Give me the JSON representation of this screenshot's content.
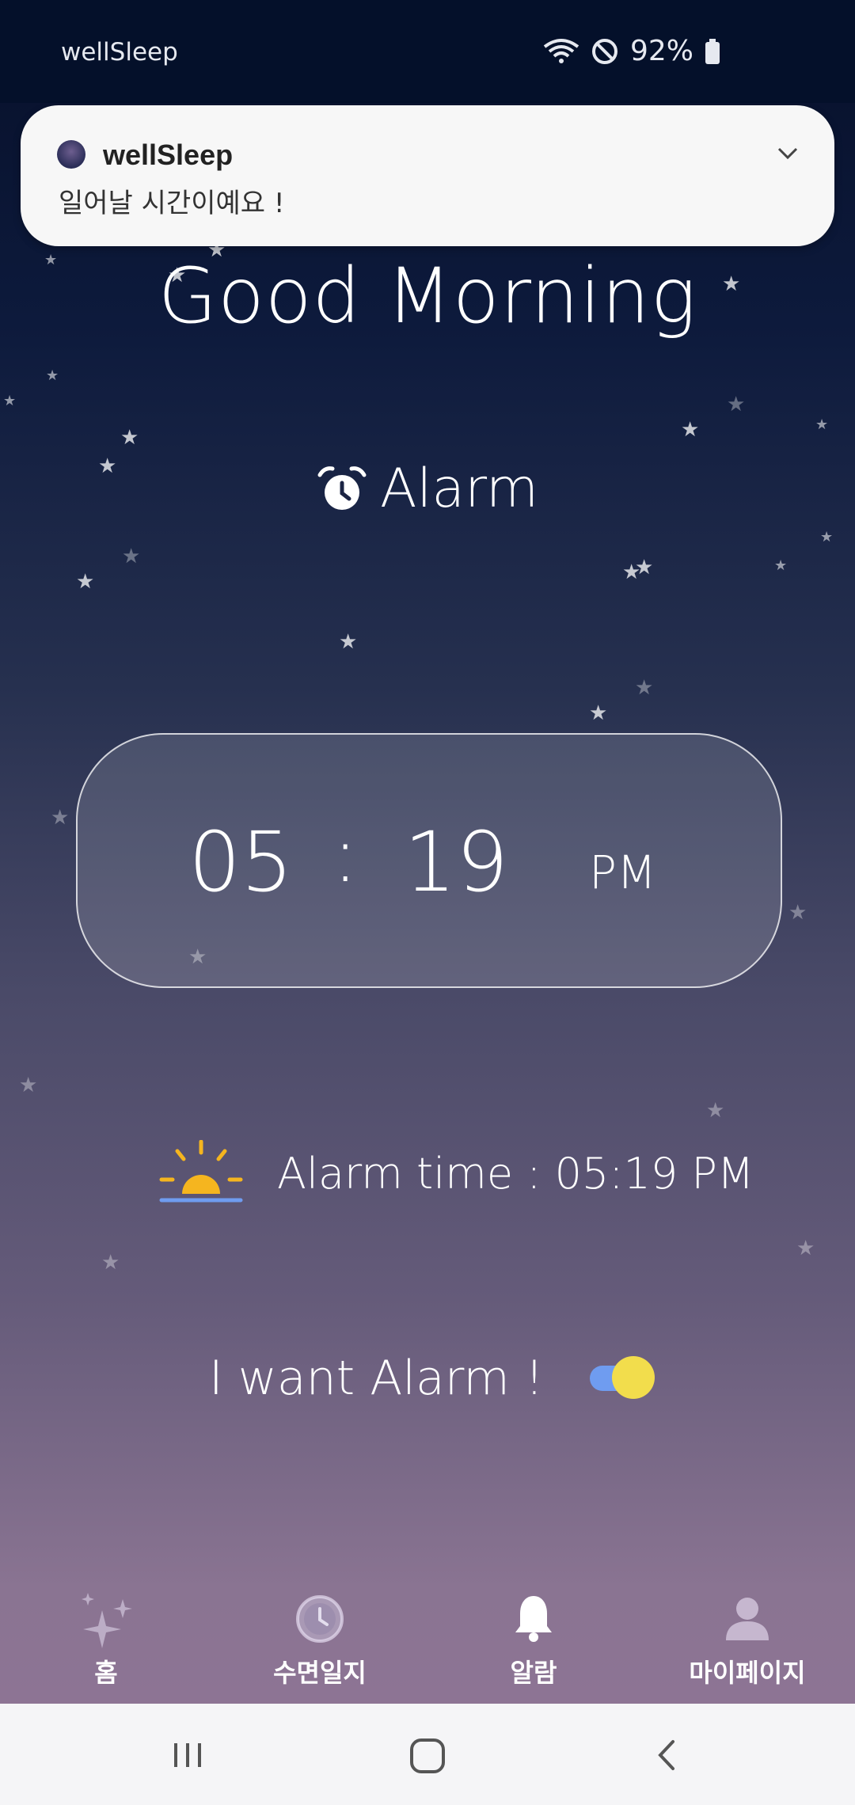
{
  "status_bar": {
    "app_name": "wellSleep",
    "battery": "92%"
  },
  "notification": {
    "app_name": "wellSleep",
    "message": "일어날 시간이예요 !"
  },
  "greeting": "Good Morning",
  "alarm_title": "Alarm",
  "time_display": {
    "hour": "05",
    "separator": ":",
    "minute": "19",
    "ampm": "PM"
  },
  "alarm_time_label": "Alarm time : 05:19 PM",
  "want_alarm": {
    "label": "I want Alarm !",
    "enabled": true
  },
  "bottom_nav": {
    "items": [
      {
        "label": "홈",
        "icon": "sparkle-icon"
      },
      {
        "label": "수면일지",
        "icon": "sleep-log-clock-icon"
      },
      {
        "label": "알람",
        "icon": "bell-icon"
      },
      {
        "label": "마이페이지",
        "icon": "person-icon"
      }
    ]
  },
  "colors": {
    "toggle_track": "#6f9cf0",
    "toggle_knob": "#f2dd4c",
    "sun": "#f5b51f",
    "horizon": "#6f9cf0"
  }
}
